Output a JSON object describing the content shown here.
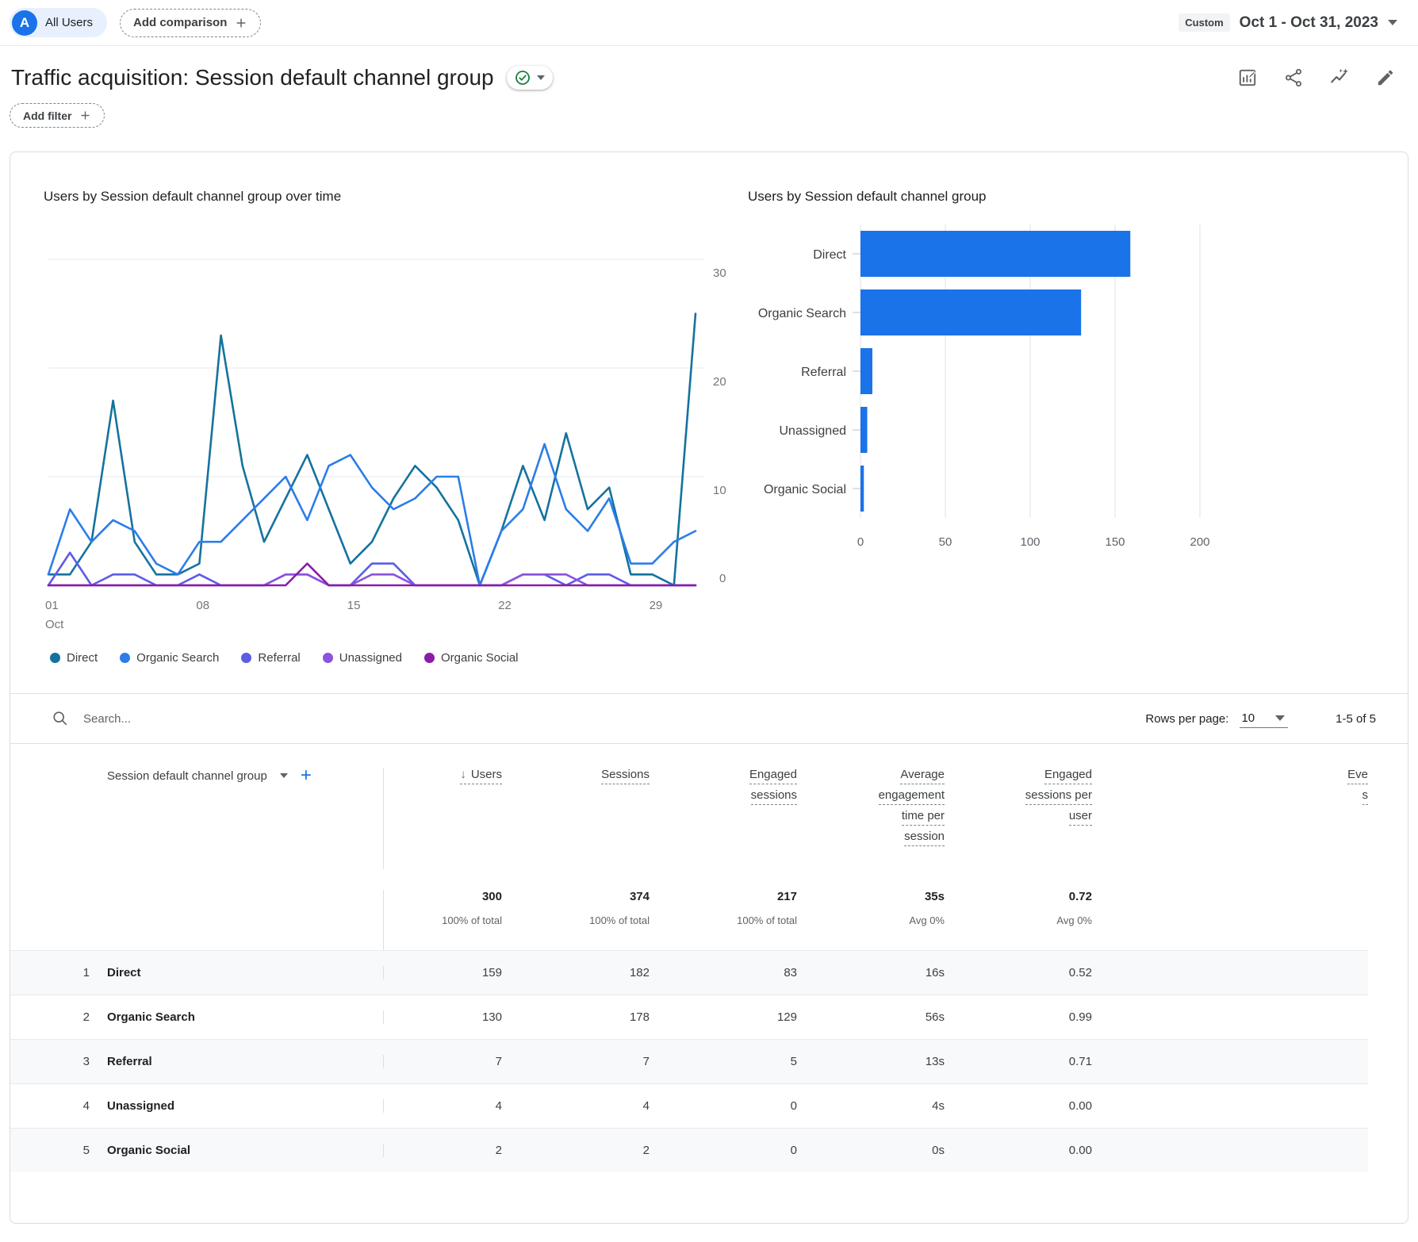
{
  "topbar": {
    "avatar_letter": "A",
    "all_users_label": "All Users",
    "add_comparison_label": "Add comparison",
    "custom_badge": "Custom",
    "date_range": "Oct 1 - Oct 31, 2023"
  },
  "report_header": {
    "title": "Traffic acquisition: Session default channel group",
    "add_filter_label": "Add filter"
  },
  "chart_data": [
    {
      "type": "line",
      "title": "Users by Session default channel group over time",
      "x_month_label": "Oct",
      "x_ticks": [
        {
          "day": 1,
          "label": "01"
        },
        {
          "day": 8,
          "label": "08"
        },
        {
          "day": 15,
          "label": "15"
        },
        {
          "day": 22,
          "label": "22"
        },
        {
          "day": 29,
          "label": "29"
        }
      ],
      "days": 31,
      "ylim": [
        0,
        30
      ],
      "y_grid_ticks": [
        10,
        20,
        30
      ],
      "y_tick_labels": [
        "30",
        "20",
        "10",
        "0"
      ],
      "grid_color": "#e8eaed",
      "axis_label_color": "#757575",
      "legend_position": "bottom",
      "series": [
        {
          "name": "Direct",
          "color": "#15729E",
          "values": [
            1,
            1,
            4,
            17,
            4,
            1,
            1,
            2,
            23,
            11,
            4,
            8,
            12,
            7,
            2,
            4,
            8,
            11,
            9,
            6,
            0,
            5,
            11,
            6,
            14,
            7,
            9,
            1,
            1,
            0,
            25
          ]
        },
        {
          "name": "Organic Search",
          "color": "#2B7DE9",
          "values": [
            1,
            7,
            4,
            6,
            5,
            2,
            1,
            4,
            4,
            6,
            8,
            10,
            6,
            11,
            12,
            9,
            7,
            8,
            10,
            10,
            0,
            5,
            7,
            13,
            7,
            5,
            8,
            2,
            2,
            4,
            5
          ]
        },
        {
          "name": "Referral",
          "color": "#5C5CE6",
          "values": [
            0,
            3,
            0,
            1,
            1,
            0,
            0,
            1,
            0,
            0,
            0,
            1,
            1,
            0,
            0,
            2,
            2,
            0,
            0,
            0,
            0,
            0,
            1,
            1,
            0,
            1,
            1,
            0,
            0,
            0,
            0
          ]
        },
        {
          "name": "Unassigned",
          "color": "#8E52DC",
          "values": [
            0,
            0,
            0,
            0,
            0,
            0,
            0,
            0,
            0,
            0,
            0,
            1,
            1,
            0,
            0,
            1,
            1,
            0,
            0,
            0,
            0,
            0,
            1,
            1,
            1,
            0,
            0,
            0,
            0,
            0,
            0
          ]
        },
        {
          "name": "Organic Social",
          "color": "#8A1CA8",
          "values": [
            0,
            0,
            0,
            0,
            0,
            0,
            0,
            0,
            0,
            0,
            0,
            0,
            2,
            0,
            0,
            0,
            0,
            0,
            0,
            0,
            0,
            0,
            0,
            0,
            0,
            0,
            0,
            0,
            0,
            0,
            0
          ]
        }
      ]
    },
    {
      "type": "bar",
      "orientation": "horizontal",
      "title": "Users by Session default channel group",
      "categories": [
        "Direct",
        "Organic Search",
        "Referral",
        "Unassigned",
        "Organic Social"
      ],
      "values": [
        159,
        130,
        7,
        4,
        2
      ],
      "xlim": [
        0,
        200
      ],
      "x_ticks": [
        0,
        50,
        100,
        150,
        200
      ],
      "bar_color": "#1A73E8",
      "grid_color": "#e0e0e0",
      "axis_label_color": "#5f6368"
    }
  ],
  "table": {
    "search_placeholder": "Search...",
    "rows_per_page_label": "Rows per page:",
    "rows_per_page_value": "10",
    "pagination_range": "1-5 of 5",
    "dimension_header": "Session default channel group",
    "columns": [
      {
        "label": "Users",
        "label_lines": [
          "Users"
        ],
        "sorted": "desc"
      },
      {
        "label": "Sessions",
        "label_lines": [
          "Sessions"
        ]
      },
      {
        "label": "Engaged sessions",
        "label_lines": [
          "Engaged",
          "sessions"
        ]
      },
      {
        "label": "Average engagement time per session",
        "label_lines": [
          "Average",
          "engagement",
          "time per",
          "session"
        ]
      },
      {
        "label": "Engaged sessions per user",
        "label_lines": [
          "Engaged",
          "sessions per",
          "user"
        ]
      },
      {
        "label": "Eve s",
        "label_lines": [
          "Eve",
          "s"
        ],
        "truncated": true
      }
    ],
    "totals": {
      "values": [
        "300",
        "374",
        "217",
        "35s",
        "0.72"
      ],
      "subs": [
        "100% of total",
        "100% of total",
        "100% of total",
        "Avg 0%",
        "Avg 0%"
      ]
    },
    "rows": [
      {
        "num": "1",
        "channel": "Direct",
        "values": [
          "159",
          "182",
          "83",
          "16s",
          "0.52"
        ]
      },
      {
        "num": "2",
        "channel": "Organic Search",
        "values": [
          "130",
          "178",
          "129",
          "56s",
          "0.99"
        ]
      },
      {
        "num": "3",
        "channel": "Referral",
        "values": [
          "7",
          "7",
          "5",
          "13s",
          "0.71"
        ]
      },
      {
        "num": "4",
        "channel": "Unassigned",
        "values": [
          "4",
          "4",
          "0",
          "4s",
          "0.00"
        ]
      },
      {
        "num": "5",
        "channel": "Organic Social",
        "values": [
          "2",
          "2",
          "0",
          "0s",
          "0.00"
        ]
      }
    ]
  }
}
